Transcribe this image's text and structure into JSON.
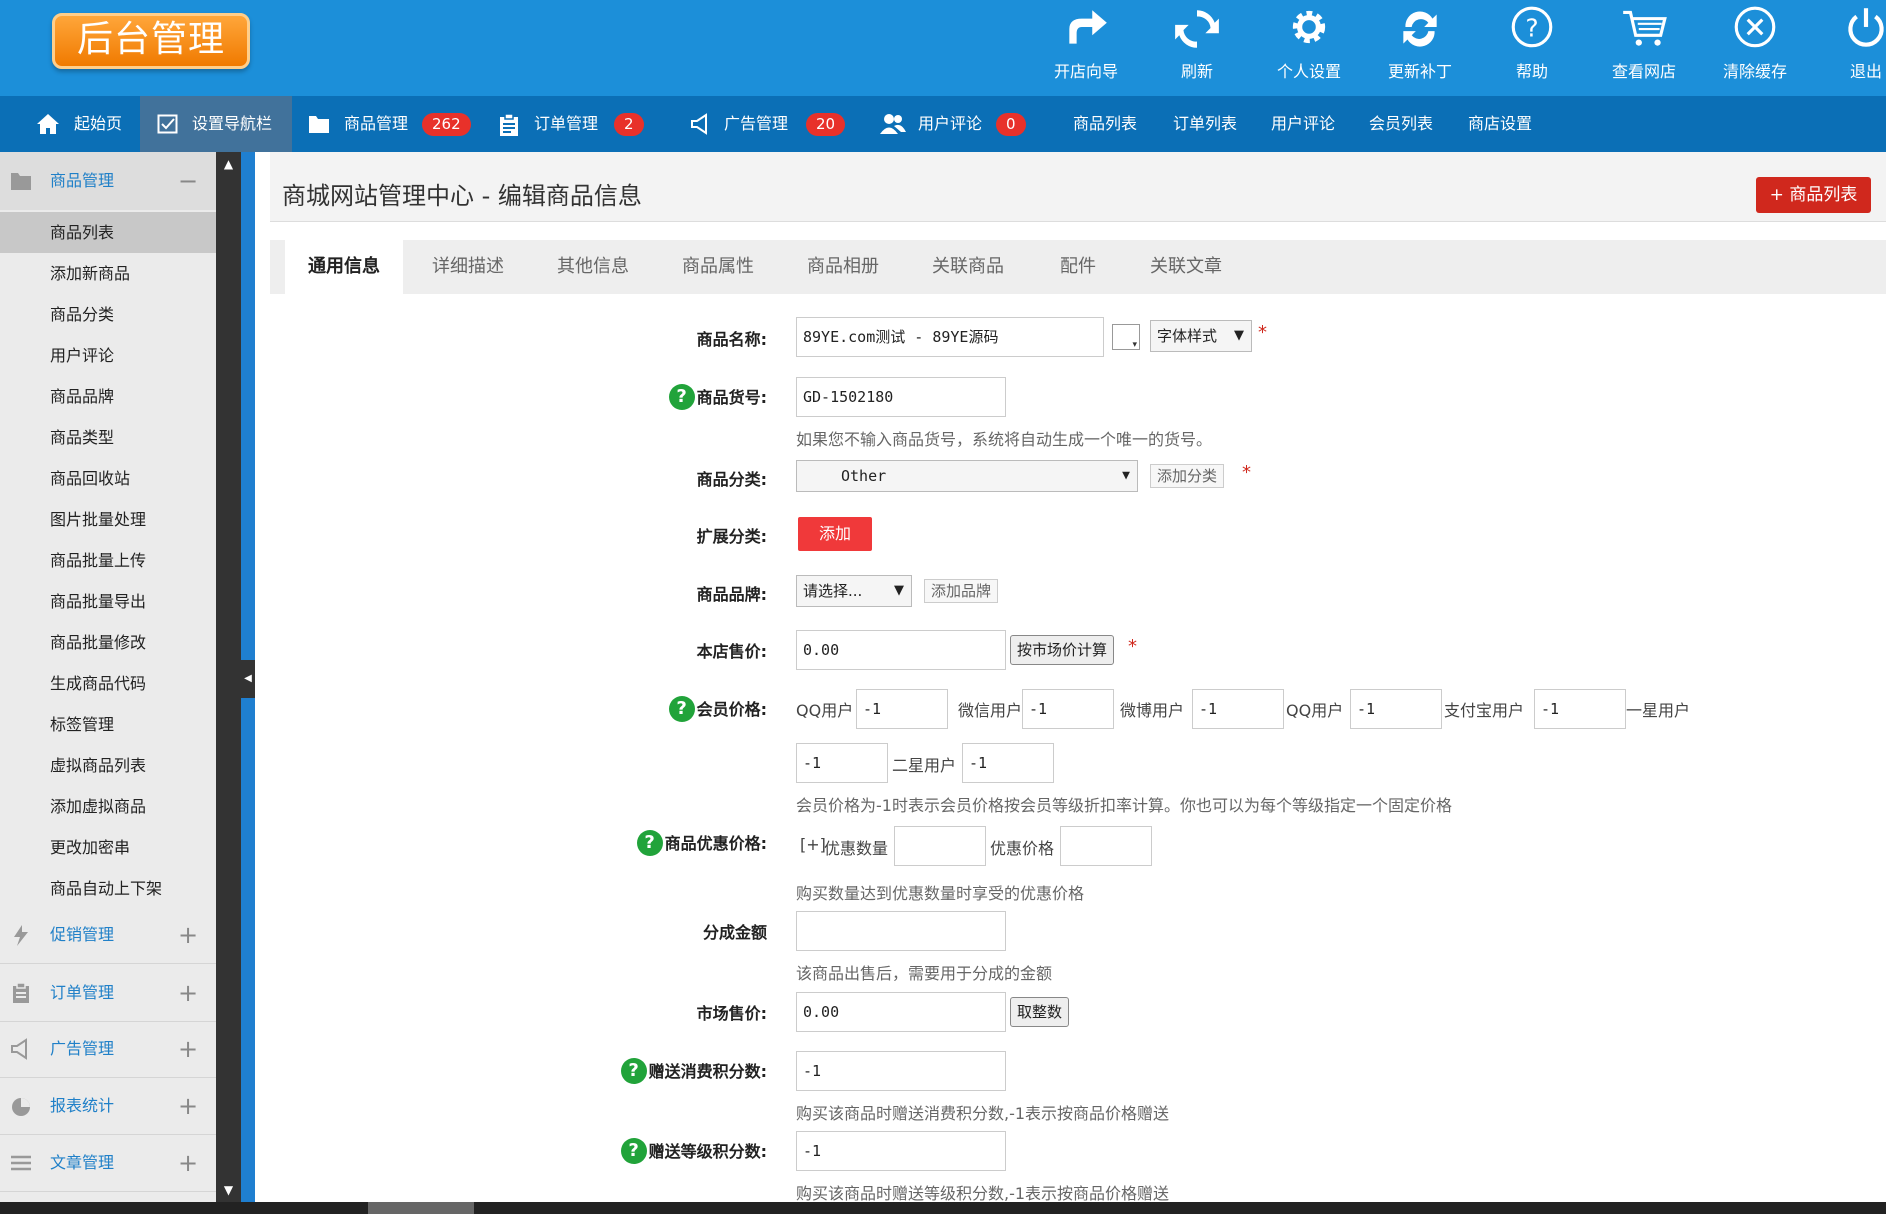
{
  "app": {
    "logo": "后台管理"
  },
  "toolbar": [
    {
      "name": "store-guide-button",
      "icon": "share-arrow-icon",
      "label": "开店向导",
      "center": 1086
    },
    {
      "name": "refresh-button",
      "icon": "refresh-icon",
      "label": "刷新",
      "center": 1197
    },
    {
      "name": "personal-settings-button",
      "icon": "gear-icon",
      "label": "个人设置",
      "center": 1309
    },
    {
      "name": "update-patch-button",
      "icon": "sync-icon",
      "label": "更新补丁",
      "center": 1420
    },
    {
      "name": "help-button",
      "icon": "help-icon",
      "label": "帮助",
      "center": 1532
    },
    {
      "name": "view-store-button",
      "icon": "cart-icon",
      "label": "查看网店",
      "center": 1644
    },
    {
      "name": "clear-cache-button",
      "icon": "close-circle-icon",
      "label": "清除缓存",
      "center": 1755
    },
    {
      "name": "logout-button",
      "icon": "power-icon",
      "label": "退出",
      "center": 1866
    }
  ],
  "nav": {
    "home": "起始页",
    "nav_settings": "设置导航栏",
    "goods": "商品管理",
    "goods_count": "262",
    "orders": "订单管理",
    "orders_count": "2",
    "ads": "广告管理",
    "ads_count": "20",
    "comments": "用户评论",
    "comments_count": "0",
    "goods_list": "商品列表",
    "order_list": "订单列表",
    "user_comments": "用户评论",
    "member_list": "会员列表",
    "shop_settings": "商店设置"
  },
  "sidebar": {
    "open_group": "商品管理",
    "items": [
      "商品列表",
      "添加新商品",
      "商品分类",
      "用户评论",
      "商品品牌",
      "商品类型",
      "商品回收站",
      "图片批量处理",
      "商品批量上传",
      "商品批量导出",
      "商品批量修改",
      "生成商品代码",
      "标签管理",
      "虚拟商品列表",
      "添加虚拟商品",
      "更改加密串",
      "商品自动上下架"
    ],
    "groups": [
      "促销管理",
      "订单管理",
      "广告管理",
      "报表统计",
      "文章管理"
    ]
  },
  "page": {
    "title": "商城网站管理中心 - 编辑商品信息",
    "list_button": "商品列表"
  },
  "tabs": [
    "通用信息",
    "详细描述",
    "其他信息",
    "商品属性",
    "商品相册",
    "关联商品",
    "配件",
    "关联文章"
  ],
  "form": {
    "name_label": "商品名称:",
    "name_value": "89YE.com测试 - 89YE源码",
    "font_style": "字体样式",
    "sn_label": "商品货号:",
    "sn_value": "GD-1502180",
    "sn_hint": "如果您不输入商品货号，系统将自动生成一个唯一的货号。",
    "cat_label": "商品分类:",
    "cat_value": "Other",
    "add_cat": "添加分类",
    "ext_cat_label": "扩展分类:",
    "ext_add": "添加",
    "brand_label": "商品品牌:",
    "brand_value": "请选择...",
    "add_brand": "添加品牌",
    "price_label": "本店售价:",
    "price_value": "0.00",
    "calc_button": "按市场价计算",
    "member_label": "会员价格:",
    "member_prices": [
      {
        "label": "QQ用户",
        "value": "-1"
      },
      {
        "label": "微信用户",
        "value": "-1"
      },
      {
        "label": "微博用户",
        "value": "-1"
      },
      {
        "label": "QQ用户",
        "value": "-1"
      },
      {
        "label": "支付宝用户",
        "value": "-1"
      },
      {
        "label": "一星用户",
        "value": "-1"
      },
      {
        "label": "二星用户",
        "value": "-1"
      }
    ],
    "member_hint": "会员价格为-1时表示会员价格按会员等级折扣率计算。你也可以为每个等级指定一个固定价格",
    "promo_label": "商品优惠价格:",
    "promo_plus": "[+]",
    "promo_qty": "优惠数量",
    "promo_price": "优惠价格",
    "promo_hint": "购买数量达到优惠数量时享受的优惠价格",
    "split_label": "分成金额",
    "split_hint": "该商品出售后，需要用于分成的金额",
    "market_label": "市场售价:",
    "market_value": "0.00",
    "round_button": "取整数",
    "give_points_label": "赠送消费积分数:",
    "give_points_value": "-1",
    "give_points_hint": "购买该商品时赠送消费积分数,-1表示按商品价格赠送",
    "rank_points_label": "赠送等级积分数:",
    "rank_points_value": "-1",
    "rank_points_hint": "购买该商品时赠送等级积分数,-1表示按商品价格赠送"
  }
}
